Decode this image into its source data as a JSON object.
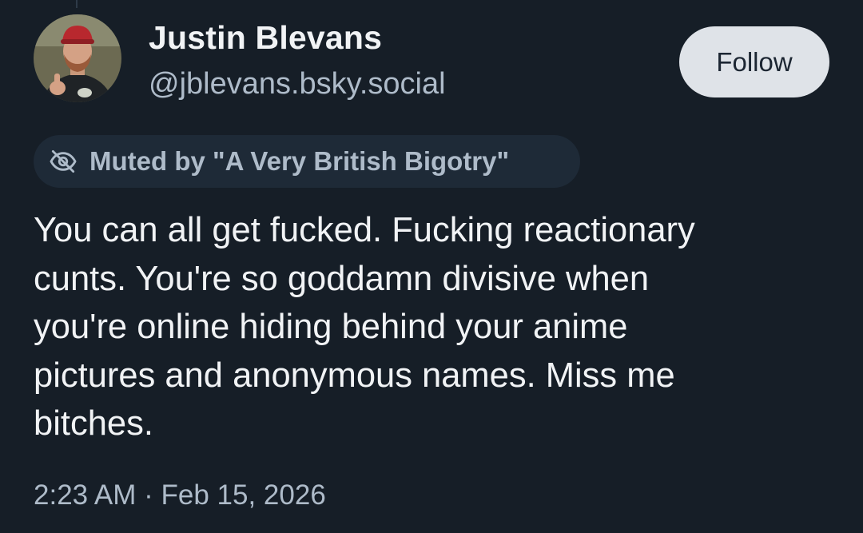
{
  "post": {
    "author": {
      "display_name": "Justin Blevans",
      "handle": "@jblevans.bsky.social",
      "avatar_icon": "user-avatar-photo"
    },
    "follow_label": "Follow",
    "moderation": {
      "icon": "eye-slash-icon",
      "label": "Muted by \"A Very British Bigotry\""
    },
    "text": "You can all get fucked. Fucking reactionary\ncunts. You're so goddamn divisive when\nyou're online hiding behind your anime\npictures and anonymous names. Miss me\nbitches.",
    "timestamp": "2:23 AM · Feb 15, 2026"
  },
  "colors": {
    "background": "#161e27",
    "primary_text": "#f1f3f5",
    "secondary_text": "#aebbc9",
    "follow_button_bg": "#dfe3e8",
    "badge_bg": "#1e2a37"
  }
}
